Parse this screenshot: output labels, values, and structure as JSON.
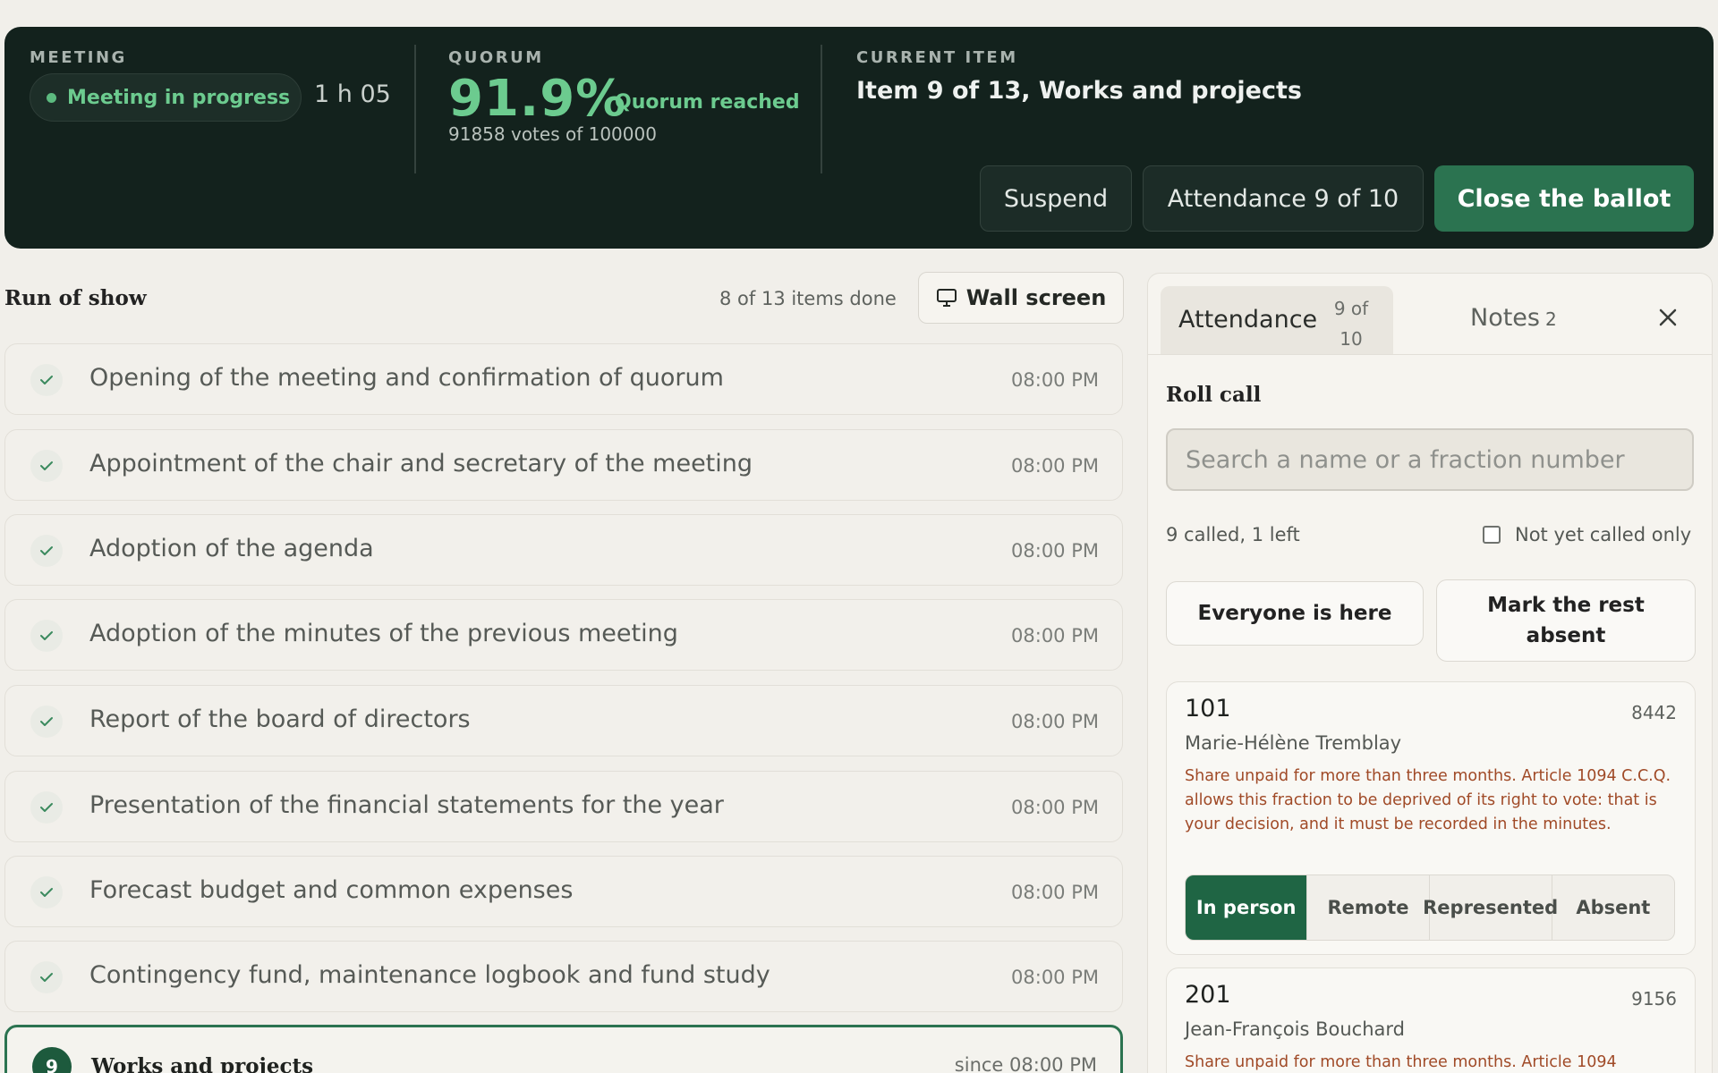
{
  "header": {
    "meeting_label": "MEETING",
    "status": "Meeting in progress",
    "elapsed": "1 h 05",
    "quorum_label": "QUORUM",
    "quorum_pct": "91.9%",
    "quorum_status": "Quorum reached",
    "quorum_votes": "91858 votes of 100000",
    "current_label": "CURRENT ITEM",
    "current_title": "Item 9 of 13, Works and projects",
    "suspend_label": "Suspend",
    "attendance_label": "Attendance 9 of 10",
    "close_ballot_label": "Close the ballot"
  },
  "run": {
    "title": "Run of show",
    "count": "8 of 13 items done",
    "wall_label": "Wall screen",
    "items": [
      {
        "title": "Opening of the meeting and confirmation of quorum",
        "time": "08:00 PM"
      },
      {
        "title": "Appointment of the chair and secretary of the meeting",
        "time": "08:00 PM"
      },
      {
        "title": "Adoption of the agenda",
        "time": "08:00 PM"
      },
      {
        "title": "Adoption of the minutes of the previous meeting",
        "time": "08:00 PM"
      },
      {
        "title": "Report of the board of directors",
        "time": "08:00 PM"
      },
      {
        "title": "Presentation of the financial statements for the year",
        "time": "08:00 PM"
      },
      {
        "title": "Forecast budget and common expenses",
        "time": "08:00 PM"
      },
      {
        "title": "Contingency fund, maintenance logbook and fund study",
        "time": "08:00 PM"
      }
    ],
    "current": {
      "number": "9",
      "title": "Works and projects",
      "time": "since 08:00 PM"
    }
  },
  "panel": {
    "tab_attendance": "Attendance",
    "tab_attendance_count_a": "9 of",
    "tab_attendance_count_b": "10",
    "tab_notes": "Notes",
    "tab_notes_count": "2",
    "roll_title": "Roll call",
    "search_placeholder": "Search a name or a fraction number",
    "called": "9 called, 1 left",
    "not_yet_label": "Not yet called only",
    "everyone_label": "Everyone is here",
    "mark_rest_a": "Mark the rest",
    "mark_rest_b": "absent",
    "fractions": [
      {
        "number": "101",
        "votes": "8442",
        "name": "Marie-Hélène Tremblay",
        "warning": "Share unpaid for more than three months. Article 1094 C.C.Q. allows this fraction to be deprived of its right to vote: that is your decision, and it must be recorded in the minutes.",
        "options": [
          "In person",
          "Remote",
          "Represented",
          "Absent"
        ],
        "selected": "In person"
      },
      {
        "number": "201",
        "votes": "9156",
        "name": "Jean-François Bouchard",
        "warning": "Share unpaid for more than three months. Article 1094"
      }
    ]
  },
  "colors": {
    "header_bg": "#13221d",
    "accent_green": "#2b7350",
    "quorum_green": "#6ccb8f",
    "warning": "#a04a27"
  }
}
